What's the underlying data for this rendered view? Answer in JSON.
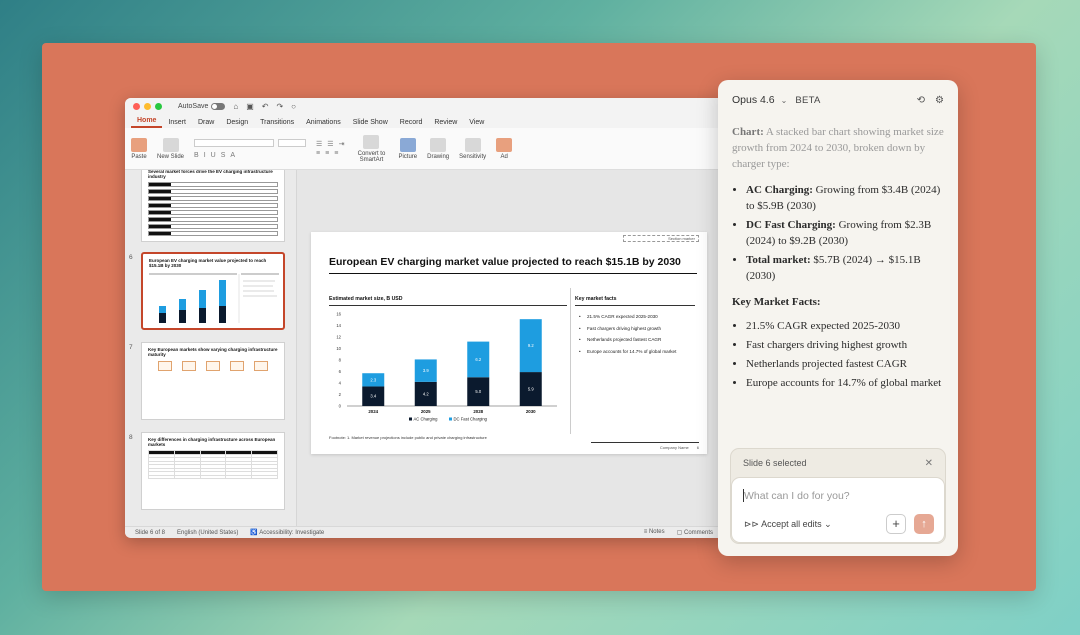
{
  "ppt": {
    "autosave_label": "AutoSave",
    "tabs": [
      "Home",
      "Insert",
      "Draw",
      "Design",
      "Transitions",
      "Animations",
      "Slide Show",
      "Record",
      "Review",
      "View"
    ],
    "ribbon": {
      "paste": "Paste",
      "new_slide": "New Slide",
      "convert_smartart": "Convert to SmartArt",
      "picture": "Picture",
      "drawing": "Drawing",
      "sensitivity": "Sensitivity",
      "ad": "Ad"
    },
    "thumbnails": [
      {
        "num": "",
        "title": "Several market forces drive the EV charging infrastructure industry"
      },
      {
        "num": "6",
        "title": "European EV charging market value projected to reach $15.1B by 2030"
      },
      {
        "num": "7",
        "title": "Key European markets show varying charging infrastructure maturity"
      },
      {
        "num": "8",
        "title": "Key differences in charging infrastructure across European markets"
      }
    ],
    "slide": {
      "tag": "Section marker",
      "title": "European EV charging market value projected to reach $15.1B by 2030",
      "chart_heading": "Estimated market size, B USD",
      "facts_heading": "Key market facts",
      "facts": [
        "21.5% CAGR expected 2025-2030",
        "Fast chargers driving highest growth",
        "Netherlands projected fastest CAGR",
        "Europe accounts for 14.7% of global market"
      ],
      "footnote": "Footnote: 1. Market revenue projections include public and private charging infrastructure",
      "footer_company": "Company Name",
      "footer_page": "6"
    },
    "status": {
      "slide_of": "Slide 6 of 8",
      "language": "English (United States)",
      "accessibility": "Accessibility: Investigate",
      "notes": "Notes",
      "comments": "Comments"
    }
  },
  "chart_data": {
    "type": "bar",
    "stacked": true,
    "categories": [
      "2024",
      "2025",
      "2028",
      "2030"
    ],
    "series": [
      {
        "name": "AC Charging",
        "values": [
          3.4,
          4.2,
          5.0,
          5.9
        ],
        "color": "#0b1a2e"
      },
      {
        "name": "DC Fast Charging",
        "values": [
          2.3,
          3.9,
          6.2,
          9.2
        ],
        "color": "#1e9de0"
      }
    ],
    "labels": [
      [
        "3.4",
        "4.2",
        "5.0",
        "5.9"
      ],
      [
        "2.3",
        "3.9",
        "6.2",
        "9.2"
      ]
    ],
    "yticks": [
      "0",
      "2",
      "4",
      "6",
      "8",
      "10",
      "12",
      "14",
      "16"
    ],
    "ylim": [
      0,
      16
    ],
    "legend_position": "bottom"
  },
  "panel": {
    "model": "Opus 4.6",
    "beta": "BETA",
    "intro_label": "Chart:",
    "intro_text": " A stacked bar chart showing market size growth from 2024 to 2030, broken down by charger type:",
    "bullets": [
      {
        "label": "AC Charging:",
        "text": " Growing from $3.4B (2024) to $5.9B (2030)"
      },
      {
        "label": "DC Fast Charging:",
        "text": " Growing from $2.3B (2024) to $9.2B (2030)"
      },
      {
        "label": "Total market:",
        "text": " $5.7B (2024) → $15.1B (2030)"
      }
    ],
    "facts_heading": "Key Market Facts:",
    "facts": [
      "21.5% CAGR expected 2025-2030",
      "Fast chargers driving highest growth",
      "Netherlands projected fastest CAGR",
      "Europe accounts for 14.7% of global market"
    ],
    "selection": "Slide 6 selected",
    "input_placeholder": "What can I do for you?",
    "accept_label": "Accept all edits"
  }
}
